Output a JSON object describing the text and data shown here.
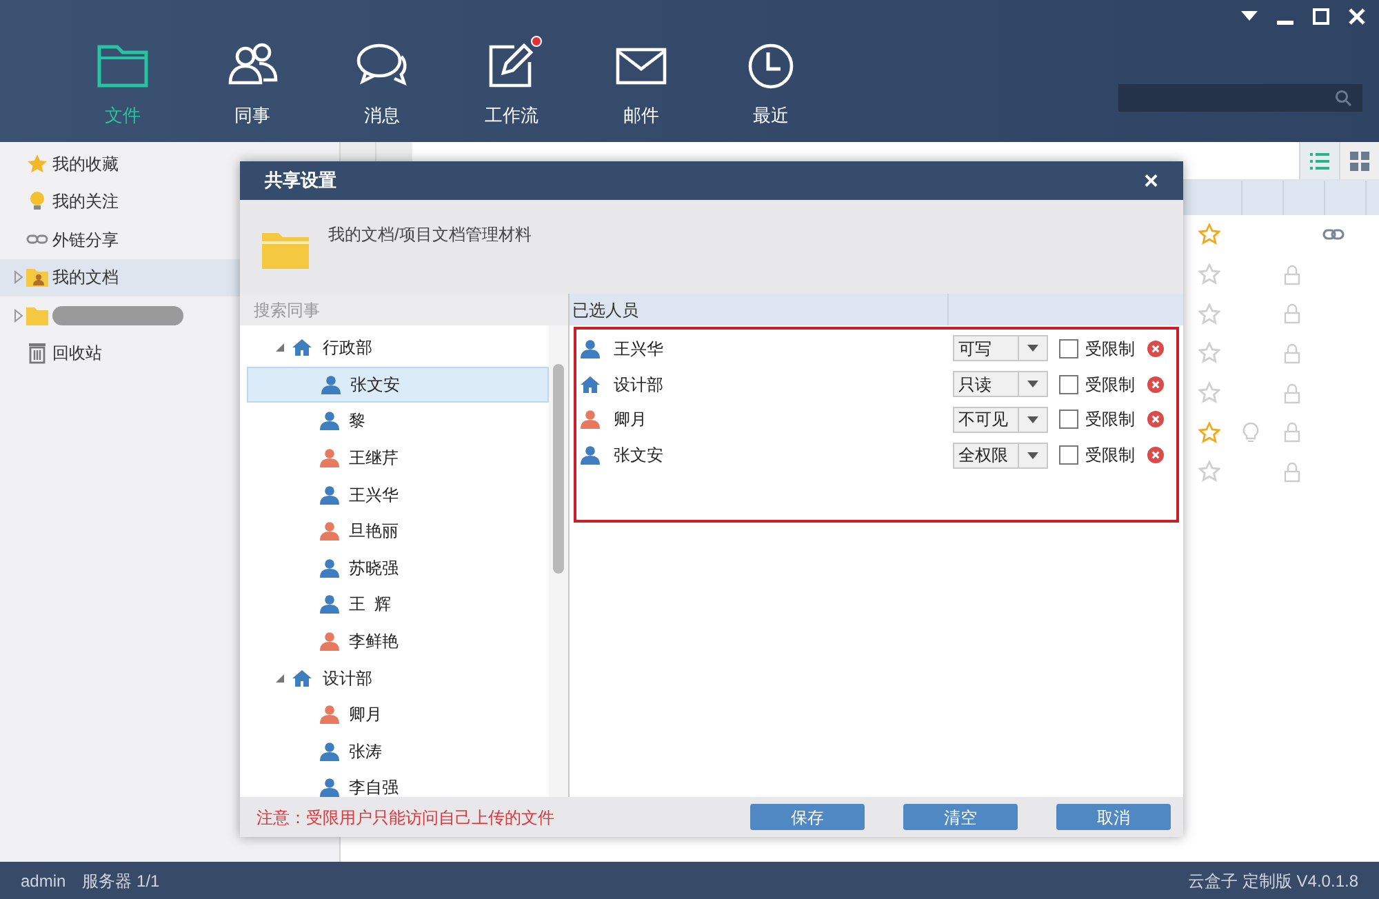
{
  "nav": [
    {
      "label": "文件",
      "selected": true,
      "badge": false
    },
    {
      "label": "同事",
      "selected": false,
      "badge": false
    },
    {
      "label": "消息",
      "selected": false,
      "badge": false
    },
    {
      "label": "工作流",
      "selected": false,
      "badge": true
    },
    {
      "label": "邮件",
      "selected": false,
      "badge": false
    },
    {
      "label": "最近",
      "selected": false,
      "badge": false
    }
  ],
  "sidebar": {
    "items": [
      {
        "label": "我的收藏",
        "selected": false,
        "expandable": false
      },
      {
        "label": "我的关注",
        "selected": false,
        "expandable": false
      },
      {
        "label": "外链分享",
        "selected": false,
        "expandable": false
      },
      {
        "label": "我的文档",
        "selected": true,
        "expandable": true
      },
      {
        "kind": "redacted",
        "selected": false,
        "expandable": true
      },
      {
        "label": "回收站",
        "selected": false,
        "expandable": false
      }
    ]
  },
  "view_buttons": [
    {
      "selected": true
    },
    {
      "selected": false
    }
  ],
  "file_rows": [
    {
      "starred": true,
      "followed": false,
      "locked": false,
      "linked": true
    },
    {
      "starred": false,
      "followed": false,
      "locked": true,
      "linked": false
    },
    {
      "starred": false,
      "followed": false,
      "locked": true,
      "linked": false
    },
    {
      "starred": false,
      "followed": false,
      "locked": true,
      "linked": false
    },
    {
      "starred": false,
      "followed": false,
      "locked": true,
      "linked": false
    },
    {
      "starred": true,
      "followed": true,
      "locked": true,
      "linked": false
    },
    {
      "starred": false,
      "followed": false,
      "locked": true,
      "linked": false
    }
  ],
  "dialog": {
    "title": "共享设置",
    "close": "×",
    "path": "我的文档/项目文档管理材料",
    "search": {
      "placeholder": "搜索同事"
    },
    "tree": [
      {
        "label": "行政部",
        "expanded": true,
        "children": [
          {
            "label": "张文安",
            "color": "#3c7ebf",
            "selected": true
          },
          {
            "label": "黎",
            "color": "#3c7ebf",
            "selected": false
          },
          {
            "label": "王继芹",
            "color": "#e8795e",
            "selected": false
          },
          {
            "label": "王兴华",
            "color": "#3c7ebf",
            "selected": false
          },
          {
            "label": "旦艳丽",
            "color": "#e8795e",
            "selected": false
          },
          {
            "label": "苏晓强",
            "color": "#3c7ebf",
            "selected": false
          },
          {
            "label": "王  辉",
            "color": "#3c7ebf",
            "selected": false
          },
          {
            "label": "李鲜艳",
            "color": "#e8795e",
            "selected": false
          }
        ]
      },
      {
        "label": "设计部",
        "expanded": true,
        "children": [
          {
            "label": "卿月",
            "color": "#e8795e",
            "selected": false
          },
          {
            "label": "张涛",
            "color": "#3c7ebf",
            "selected": false
          },
          {
            "label": "李自强",
            "color": "#3c7ebf",
            "selected": false
          }
        ]
      }
    ],
    "selected_header": "已选人员",
    "selected": [
      {
        "kind": "person",
        "color": "#3c7ebf",
        "name": "王兴华",
        "permission": "可写",
        "restricted": false,
        "restricted_label": "受限制"
      },
      {
        "kind": "dept",
        "color": "#3c7ebf",
        "name": "设计部",
        "permission": "只读",
        "restricted": false,
        "restricted_label": "受限制"
      },
      {
        "kind": "person",
        "color": "#e8795e",
        "name": "卿月",
        "permission": "不可见",
        "restricted": false,
        "restricted_label": "受限制"
      },
      {
        "kind": "person",
        "color": "#3c7ebf",
        "name": "张文安",
        "permission": "全权限",
        "restricted": false,
        "restricted_label": "受限制"
      }
    ],
    "notice": "注意：受限用户只能访问自己上传的文件",
    "buttons": [
      "保存",
      "清空",
      "取消"
    ]
  },
  "status_bar": {
    "user": "admin",
    "server": "服务器 1/1",
    "version": "云盒子 定制版 V4.0.1.8"
  }
}
